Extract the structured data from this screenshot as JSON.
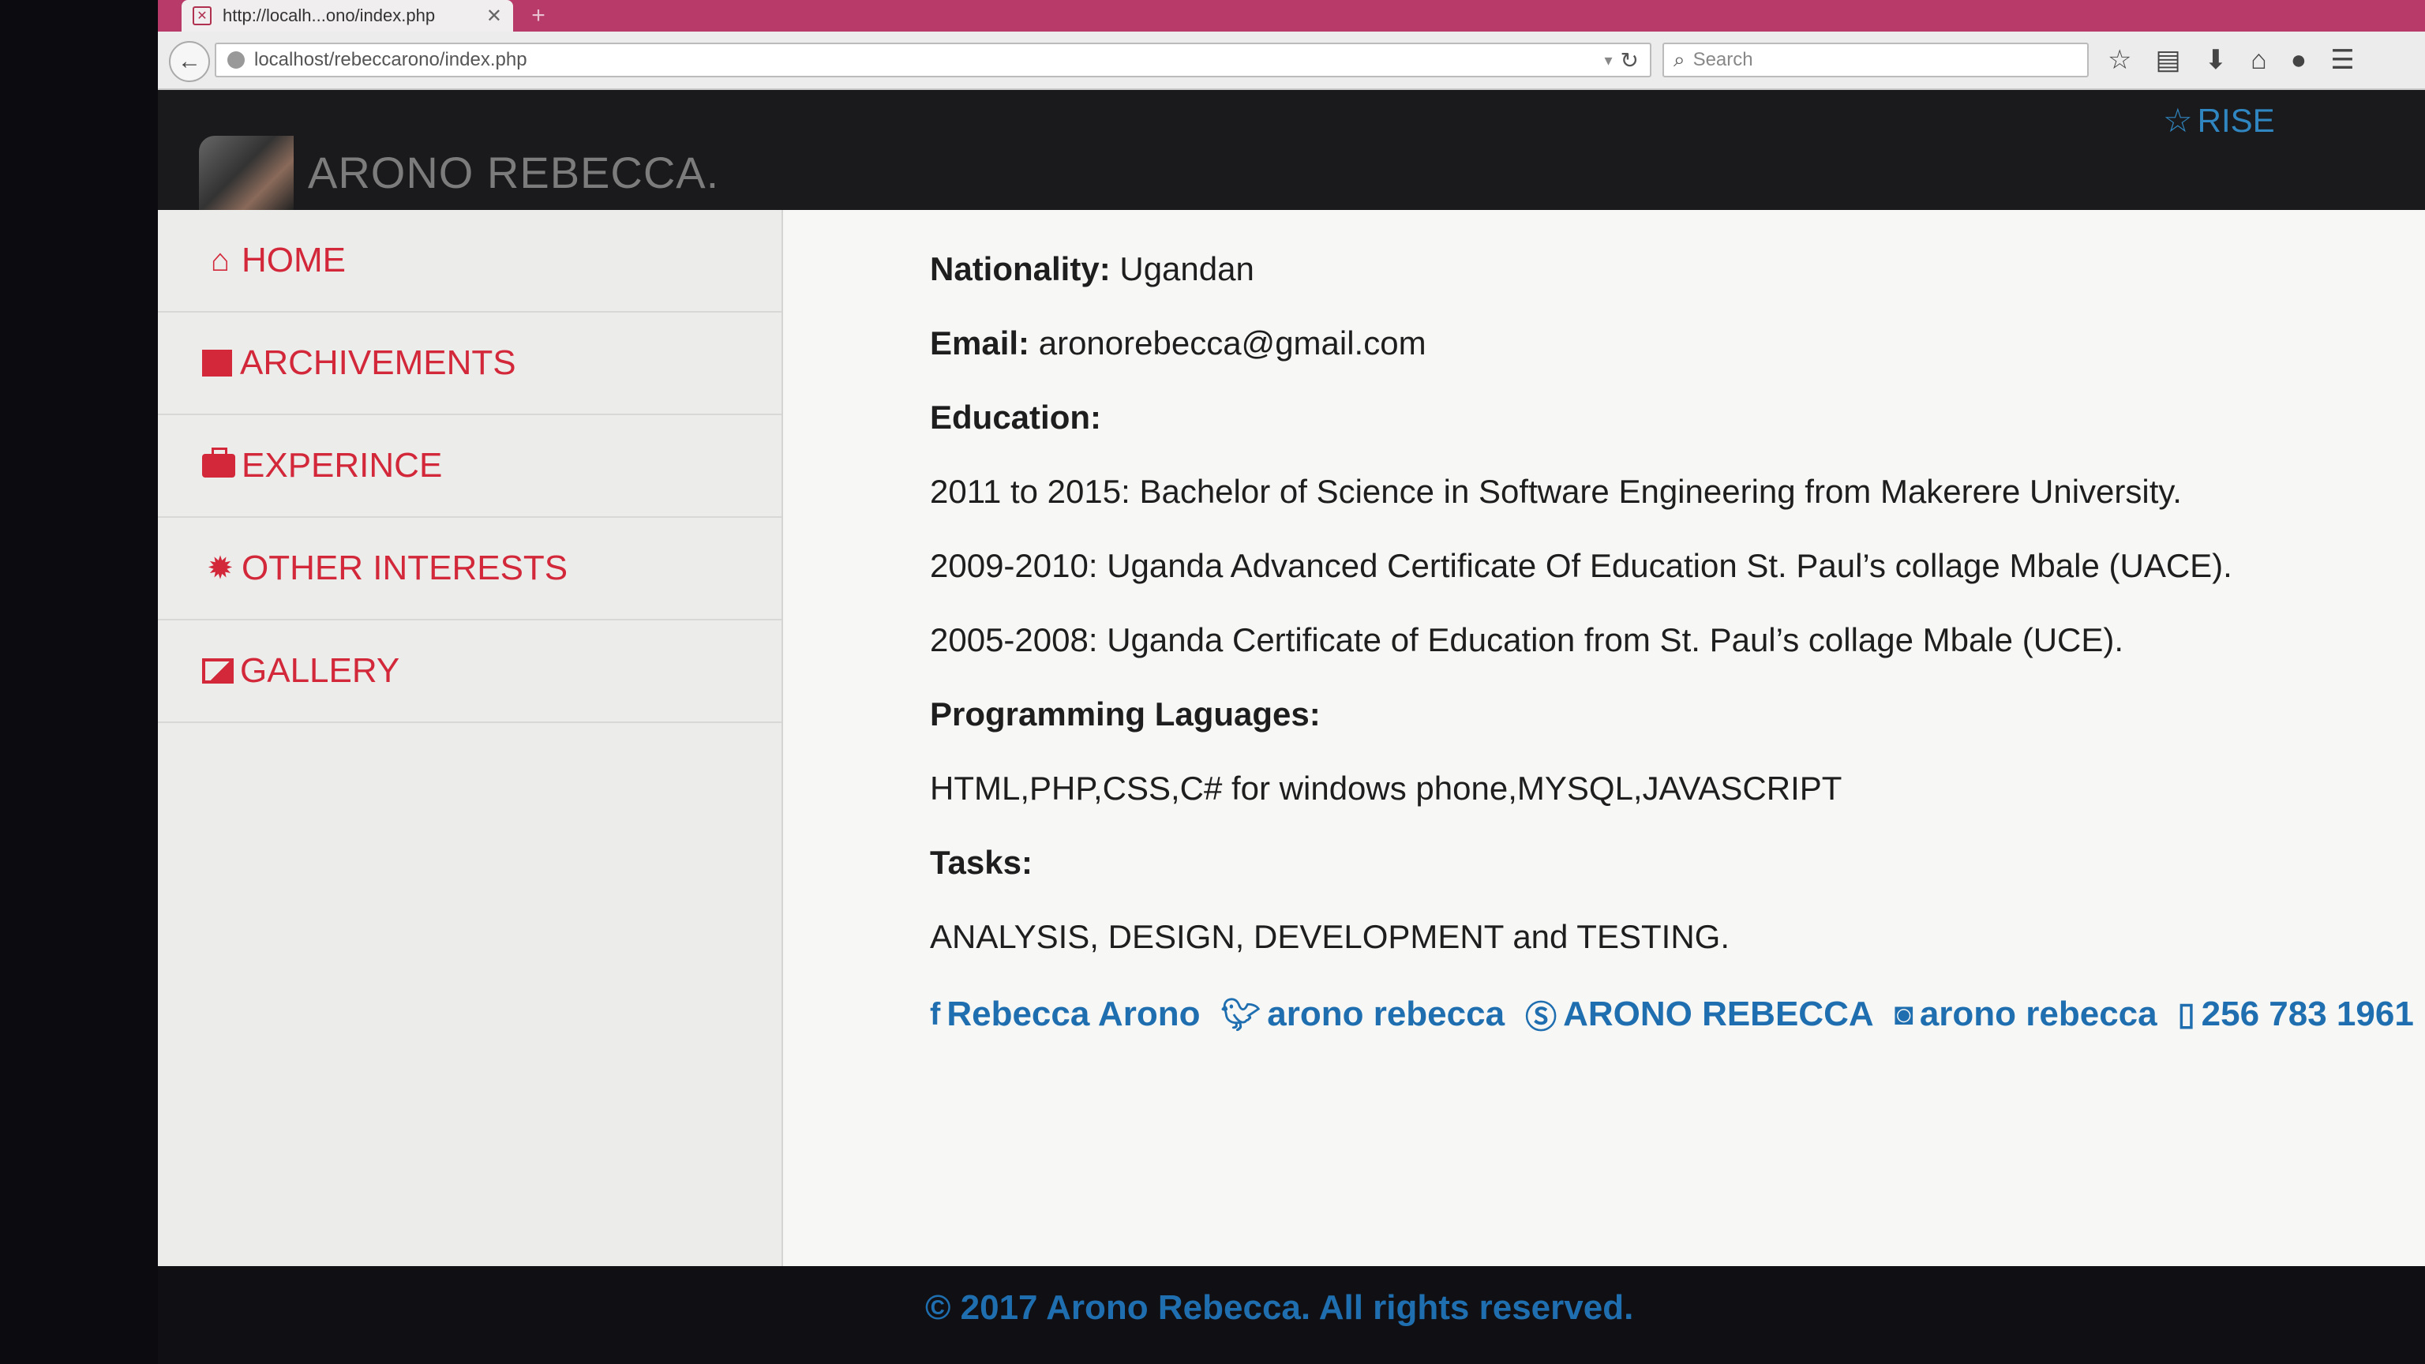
{
  "browser": {
    "tab_title": "http://localh...ono/index.php",
    "tab_close": "✕",
    "new_tab": "+",
    "url": "localhost/rebeccarono/index.php",
    "search_placeholder": "Search"
  },
  "header": {
    "site_title": "ARONO REBECCA.",
    "rise_label": "RISE"
  },
  "sidebar": {
    "items": [
      {
        "label": "HOME",
        "icon": "home-icon"
      },
      {
        "label": "ARCHIVEMENTS",
        "icon": "book-icon"
      },
      {
        "label": "EXPERINCE",
        "icon": "briefcase-icon"
      },
      {
        "label": "OTHER INTERESTS",
        "icon": "gear-icon"
      },
      {
        "label": "GALLERY",
        "icon": "picture-icon"
      }
    ]
  },
  "content": {
    "nationality_label": "Nationality:",
    "nationality_value": "Ugandan",
    "email_label": "Email:",
    "email_value": "aronorebecca@gmail.com",
    "education_label": "Education:",
    "education": [
      "2011 to 2015: Bachelor of Science in Software Engineering from Makerere University.",
      "2009-2010: Uganda Advanced Certificate Of Education St. Paul’s collage Mbale (UACE).",
      "2005-2008: Uganda Certificate of Education from St. Paul’s collage Mbale (UCE)."
    ],
    "programming_label": "Programming Laguages:",
    "programming_value": "HTML,PHP,CSS,C# for windows phone,MYSQL,JAVASCRIPT",
    "tasks_label": "Tasks:",
    "tasks_value": "ANALYSIS, DESIGN, DEVELOPMENT and TESTING."
  },
  "social": {
    "facebook": "Rebecca Arono",
    "twitter": "arono rebecca",
    "skype": "ARONO REBECCA",
    "instagram": "arono rebecca",
    "phone": "256 783 1961"
  },
  "footer": {
    "text": "© 2017 Arono Rebecca. All rights reserved."
  }
}
